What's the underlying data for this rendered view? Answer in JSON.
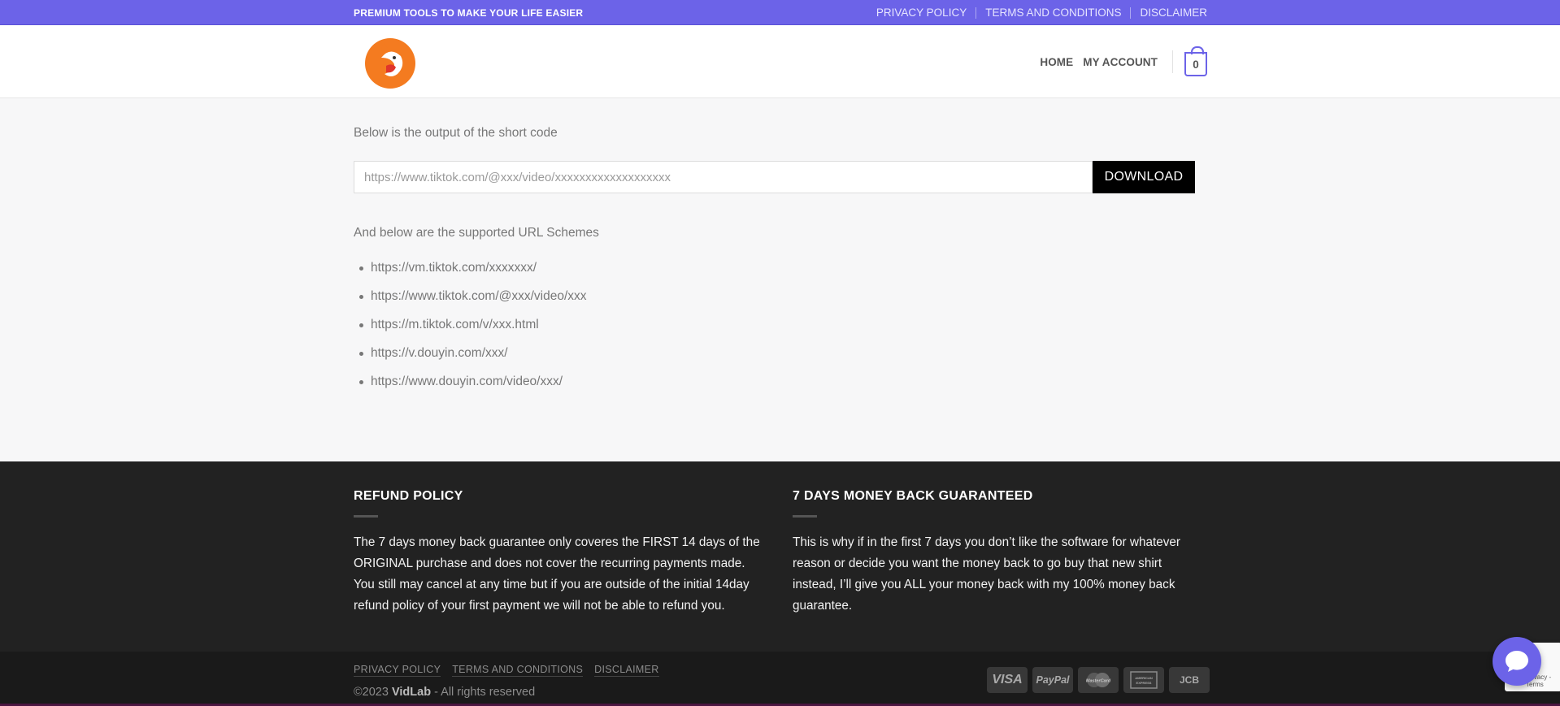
{
  "topbar": {
    "tagline": "PREMIUM TOOLS TO MAKE YOUR LIFE EASIER",
    "links": [
      "PRIVACY POLICY",
      "TERMS AND CONDITIONS",
      "DISCLAIMER"
    ]
  },
  "header": {
    "nav": [
      "HOME",
      "MY ACCOUNT"
    ],
    "cart_count": "0"
  },
  "main": {
    "intro": "Below is the output of the short code",
    "url_placeholder": "https://www.tiktok.com/@xxx/video/xxxxxxxxxxxxxxxxxxx",
    "download_label": "DOWNLOAD",
    "schemes_title": "And below are the supported URL Schemes",
    "schemes": [
      "https://vm.tiktok.com/xxxxxxx/",
      "https://www.tiktok.com/@xxx/video/xxx",
      "https://m.tiktok.com/v/xxx.html",
      "https://v.douyin.com/xxx/",
      "https://www.douyin.com/video/xxx/"
    ]
  },
  "footer": {
    "refund": {
      "title": "REFUND POLICY",
      "text": "The 7 days money back guarantee only coveres the FIRST 14 days of the ORIGINAL purchase and does not cover the recurring payments made. You still may cancel at any time but if you are outside of the initial 14day refund policy of your first payment we will not be able to refund you."
    },
    "guarantee": {
      "title": "7 DAYS MONEY BACK GUARANTEED",
      "text": "This is why if in the first 7 days you don’t like the software for whatever reason or decide you want the money back to go buy that new shirt instead, I’ll give you ALL your money back with my 100% money back guarantee."
    },
    "links": [
      "PRIVACY POLICY",
      "TERMS AND CONDITIONS",
      "DISCLAIMER"
    ],
    "copyright_prefix": "©2023 ",
    "copyright_brand": "VidLab",
    "copyright_suffix": " - All rights reserved",
    "payments": [
      "VISA",
      "PayPal",
      "MasterCard",
      "AMERICAN EXPRESS",
      "JCB"
    ]
  },
  "recaptcha_terms": "Privacy - Terms",
  "colors": {
    "accent": "#6c63e8",
    "footer_bg": "#222222",
    "button_bg": "#000000"
  }
}
